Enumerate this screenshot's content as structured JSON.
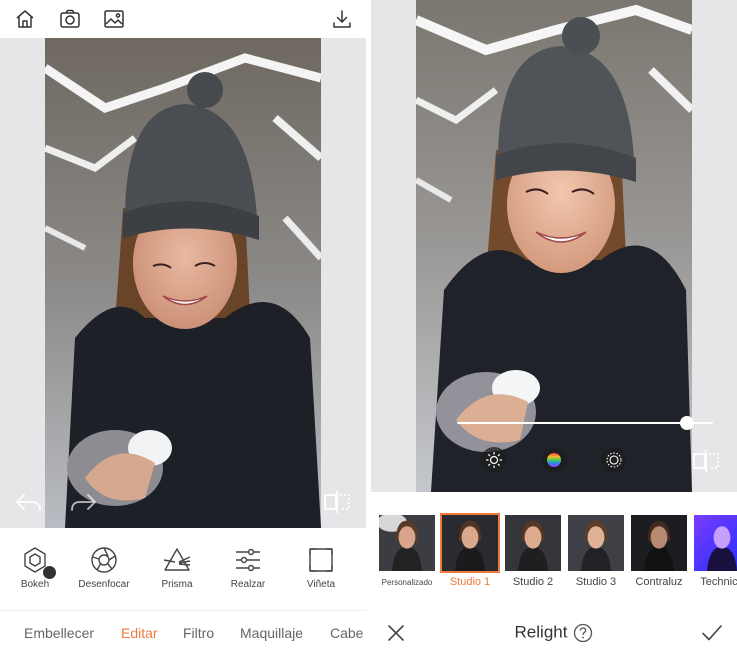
{
  "editor": {
    "toolbar": {
      "icons": [
        "home-icon",
        "camera-icon",
        "gallery-icon",
        "download-icon"
      ]
    },
    "tools": [
      {
        "label": "Bokeh",
        "icon": "bokeh-icon",
        "applied": true
      },
      {
        "label": "Desenfocar",
        "icon": "aperture-icon"
      },
      {
        "label": "Prisma",
        "icon": "prism-icon"
      },
      {
        "label": "Realzar",
        "icon": "sliders-icon"
      },
      {
        "label": "Viñeta",
        "icon": "vignette-icon"
      }
    ],
    "tabs": [
      {
        "label": "Embellecer"
      },
      {
        "label": "Editar",
        "active": true
      },
      {
        "label": "Filtro"
      },
      {
        "label": "Maquillaje"
      },
      {
        "label": "Cabe"
      }
    ],
    "accent_color": "#f07a3e"
  },
  "relight": {
    "title": "Relight",
    "slider_value": 0.9,
    "presets": [
      {
        "label": "Personalizado"
      },
      {
        "label": "Studio 1",
        "selected": true
      },
      {
        "label": "Studio 2"
      },
      {
        "label": "Studio 3"
      },
      {
        "label": "Contraluz"
      },
      {
        "label": "Technico"
      }
    ]
  }
}
